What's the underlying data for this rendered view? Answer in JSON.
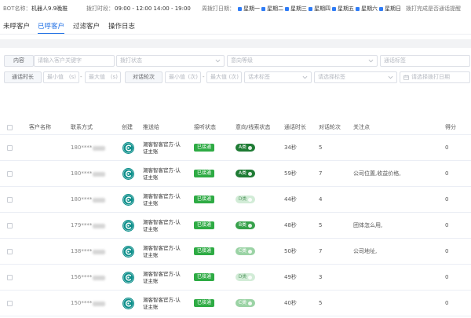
{
  "topbar": {
    "bot_label": "BOT名称：",
    "bot_name": "机器人9.9晚推",
    "period_label": "拨打时段：",
    "period_value": "09:00 - 12:00 14:00 - 19:00",
    "days_label": "周拨打日期：",
    "days": [
      "星期一",
      "星期二",
      "星期三",
      "星期四",
      "星期五",
      "星期六",
      "星期日"
    ],
    "reminder_label": "拨打完成是否通话提醒"
  },
  "tabs": [
    {
      "label": "未呼客户",
      "active": false
    },
    {
      "label": "已呼客户",
      "active": true
    },
    {
      "label": "过滤客户",
      "active": false
    },
    {
      "label": "操作日志",
      "active": false
    }
  ],
  "filters": {
    "content_label": "内容",
    "keyword_placeholder": "请输入客户关键字",
    "dial_status_placeholder": "拨打状态",
    "intent_placeholder": "意向等级",
    "call_tag_placeholder": "通话标签",
    "duration_label": "通话时长",
    "duration_min": "最小值",
    "duration_min_suffix": "(s)",
    "duration_max": "最大值",
    "duration_max_suffix": "(s)",
    "range_separator": "-",
    "rounds_label": "对话轮次",
    "rounds_min": "最小值",
    "rounds_min_suffix": "(次)",
    "rounds_max": "最大值",
    "rounds_max_suffix": "(次)",
    "script_tag_placeholder": "话术标签",
    "tag_placeholder": "请选择标签",
    "date_placeholder": "请选择拨打日期"
  },
  "table": {
    "headers": [
      "客户名称",
      "联系方式",
      "创建",
      "推送给",
      "接听状态",
      "意向/线索状态",
      "通话时长",
      "对话轮次",
      "关注点",
      "得分"
    ],
    "rows": [
      {
        "phone": "180****",
        "pushed_to": "潮客智客官方-认证主账",
        "status": "已接通",
        "intent": "A类",
        "duration": "34秒",
        "rounds": "5",
        "focus": "",
        "score": "0"
      },
      {
        "phone": "180****",
        "pushed_to": "潮客智客官方-认证主账",
        "status": "已接通",
        "intent": "A类",
        "duration": "59秒",
        "rounds": "7",
        "focus": "公司位置,收益价格,",
        "score": "0"
      },
      {
        "phone": "180****",
        "pushed_to": "潮客智客官方-认证主账",
        "status": "已接通",
        "intent": "D类",
        "duration": "44秒",
        "rounds": "4",
        "focus": "",
        "score": "0"
      },
      {
        "phone": "179****",
        "pushed_to": "潮客智客官方-认证主账",
        "status": "已接通",
        "intent": "B类",
        "duration": "48秒",
        "rounds": "5",
        "focus": "团体怎么用,",
        "score": "0"
      },
      {
        "phone": "138****",
        "pushed_to": "潮客智客官方-认证主账",
        "status": "已接通",
        "intent": "C类",
        "duration": "50秒",
        "rounds": "7",
        "focus": "公司地址,",
        "score": "0"
      },
      {
        "phone": "156****",
        "pushed_to": "潮客智客官方-认证主账",
        "status": "已接通",
        "intent": "D类",
        "duration": "49秒",
        "rounds": "3",
        "focus": "",
        "score": "0"
      },
      {
        "phone": "150****",
        "pushed_to": "潮客智客官方-认证主账",
        "status": "已接通",
        "intent": "C类",
        "duration": "40秒",
        "rounds": "5",
        "focus": "",
        "score": "0"
      }
    ]
  },
  "icons": {
    "select_arrow": "chevron-down-icon",
    "date_picker": "calendar-icon",
    "day_checked": "checked-square-icon",
    "avatar": "bot-logo-avatar-icon"
  },
  "colors": {
    "accent": "#1f6fe5",
    "day_tag": "#2f7cf6",
    "status_green": "#2eab44",
    "avatar_teal": "#0d8f8b",
    "intent": {
      "A": "#1e7b34",
      "B": "#37a14b",
      "C": "#9bd3a5",
      "D": "#d2ecd7"
    },
    "intent_text": {
      "A": "#ffffff",
      "B": "#ffffff",
      "C": "#ffffff",
      "D": "#5f9f6b"
    }
  }
}
